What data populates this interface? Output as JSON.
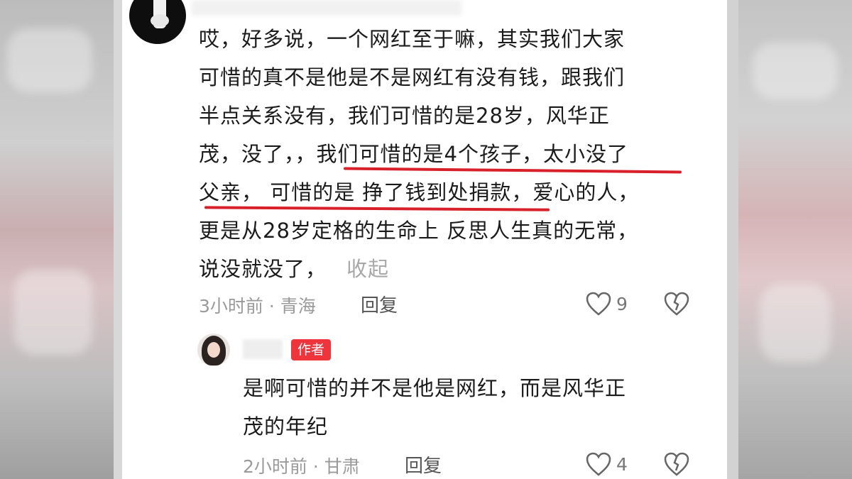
{
  "comment": {
    "lines": [
      "哎，好多说，一个网红至于嘛，其实我们大家",
      "可惜的真不是他是不是网红有没有钱，跟我们",
      "半点关系没有，我们可惜的是28岁，风华正",
      "茂，没了，，我们可惜的是4个孩子，太小没了",
      "父亲， 可惜的是 挣了钱到处捐款，爱心的人，",
      "更是从28岁定格的生命上 反思人生真的无常，",
      "说没就没了，"
    ],
    "collapse_label": "收起",
    "meta": "3小时前 · 青海",
    "reply_label": "回复",
    "like_count": "9"
  },
  "reply": {
    "badge": "作者",
    "lines": [
      "是啊可惜的并不是他是网红，而是风华正",
      "茂的年纪"
    ],
    "meta": "2小时前 · 甘肃",
    "reply_label": "回复",
    "like_count": "4"
  },
  "colors": {
    "underline": "#d8202a",
    "badge": "#f0343c",
    "text": "#1b1b1b",
    "meta": "#9a9a9a"
  },
  "icons": [
    "heart-icon",
    "broken-heart-icon"
  ]
}
